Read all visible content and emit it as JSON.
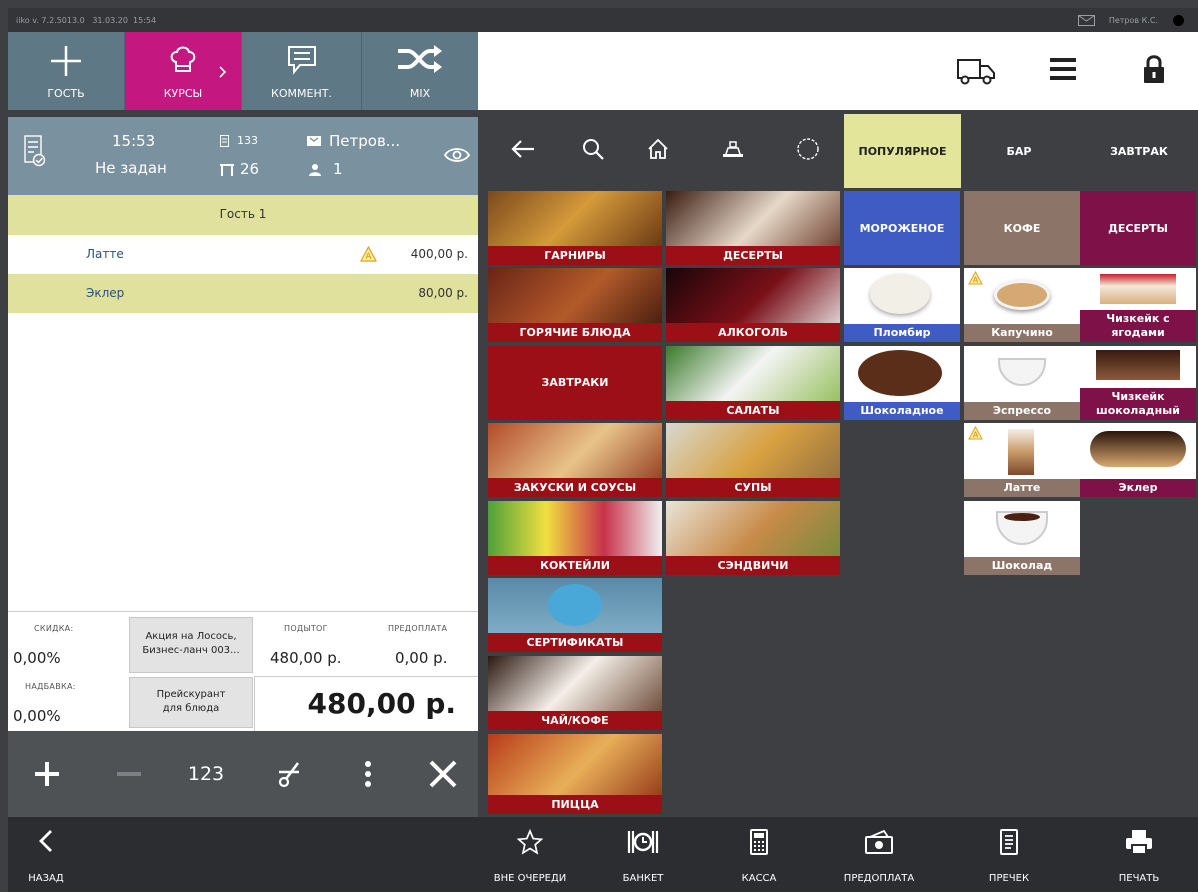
{
  "status_bar": {
    "version": "iiko v. 7.2.5013.0",
    "date": "31.03.20",
    "time": "15:54",
    "user": "Петров К.С."
  },
  "toolbar": {
    "guest_label": "ГОСТЬ",
    "courses_label": "КУРСЫ",
    "comment_label": "КОММЕНТ.",
    "mix_label": "MIX"
  },
  "order_header": {
    "time": "15:53",
    "status": "Не задан",
    "order_number": "133",
    "table": "26",
    "waiter": "Петров...",
    "guests": "1"
  },
  "order": {
    "guest_title": "Гость 1",
    "items": [
      {
        "name": "Латте",
        "price": "400,00 р."
      },
      {
        "name": "Эклер",
        "price": "80,00 р."
      }
    ]
  },
  "totals": {
    "discount_label": "СКИДКА:",
    "discount_value": "0,00%",
    "markup_label": "НАДБАВКА:",
    "markup_value": "0,00%",
    "promo_text_1": "Акция на Лосось,",
    "promo_text_2": "Бизнес-ланч 003...",
    "pricelist_1": "Прейскурант",
    "pricelist_2": "для блюда",
    "subtotal_label": "ПОДЫТОГ",
    "subtotal_value": "480,00 р.",
    "prepay_label": "ПРЕДОПЛАТА",
    "prepay_value": "0,00 р.",
    "total_value": "480,00 р."
  },
  "order_tools": {
    "qty_label": "123"
  },
  "filters": {
    "popular": "ПОПУЛЯРНОЕ",
    "bar": "БАР",
    "breakfast": "ЗАВТРАК"
  },
  "categories": [
    "ГАРНИРЫ",
    "ДЕСЕРТЫ",
    "ГОРЯЧИЕ БЛЮДА",
    "АЛКОГОЛЬ",
    "ЗАВТРАКИ",
    "САЛАТЫ",
    "ЗАКУСКИ И СОУСЫ",
    "СУПЫ",
    "КОКТЕЙЛИ",
    "СЭНДВИЧИ",
    "СЕРТИФИКАТЫ",
    "ЧАЙ/КОФЕ",
    "ПИЦЦА"
  ],
  "subcategories": {
    "ice_cream": "МОРОЖЕНОЕ",
    "coffee": "КОФЕ",
    "desserts": "ДЕСЕРТЫ"
  },
  "products": {
    "plombir": "Пломбир",
    "chocolate_ice": "Шоколадное",
    "cappuccino": "Капучино",
    "espresso": "Эспрессо",
    "latte": "Латте",
    "chocolate": "Шоколад",
    "cheesecake_berries_1": "Чизкейк с",
    "cheesecake_berries_2": "ягодами",
    "cheesecake_choc_1": "Чизкейк",
    "cheesecake_choc_2": "шоколадный",
    "eclair": "Эклер"
  },
  "bottom_bar": {
    "back": "НАЗАД",
    "out_of_queue": "ВНЕ ОЧЕРЕДИ",
    "banquet": "БАНКЕТ",
    "cashier": "КАССА",
    "prepayment": "ПРЕДОПЛАТА",
    "precheck": "ПРЕЧЕК",
    "print": "ПЕЧАТЬ"
  },
  "colors": {
    "accent_magenta": "#c4177f",
    "category_red": "#9d0f16",
    "tab_active": "#e3e59a",
    "ice_cream_blue": "#3e5cc4",
    "coffee_brown": "#8c7468",
    "dessert_purple": "#7d1148",
    "guest_row": "#dfe19c"
  }
}
